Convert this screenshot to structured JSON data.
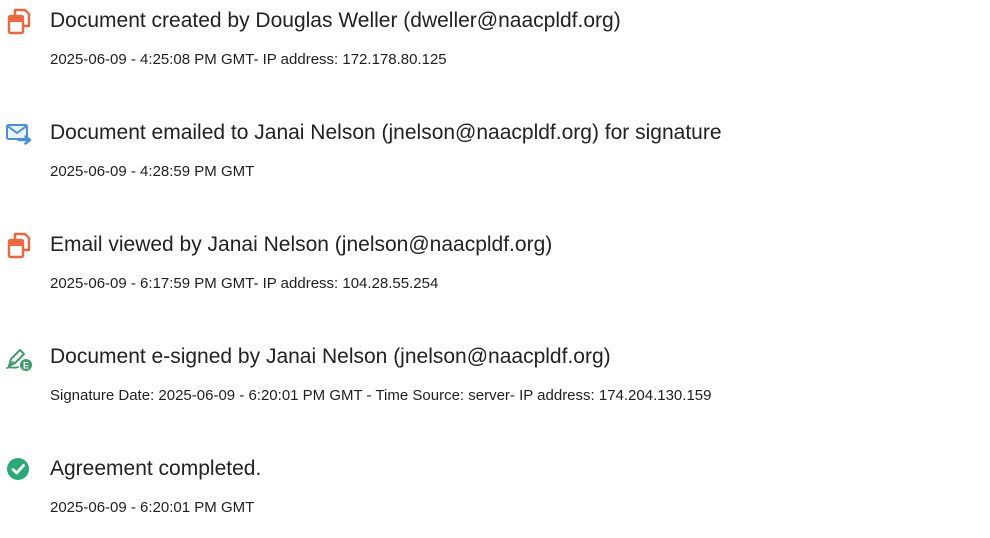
{
  "events": [
    {
      "icon": "document-created-icon",
      "title": "Document created by Douglas Weller (dweller@naacpldf.org)",
      "detail": "2025-06-09 - 4:25:08 PM GMT- IP address: 172.178.80.125"
    },
    {
      "icon": "email-sent-icon",
      "title": "Document emailed to Janai Nelson (jnelson@naacpldf.org) for signature",
      "detail": "2025-06-09 - 4:28:59 PM GMT"
    },
    {
      "icon": "email-viewed-icon",
      "title": "Email viewed by Janai Nelson (jnelson@naacpldf.org)",
      "detail": "2025-06-09 - 6:17:59 PM GMT- IP address: 104.28.55.254"
    },
    {
      "icon": "e-signature-icon",
      "title": "Document e-signed by Janai Nelson (jnelson@naacpldf.org)",
      "detail": "Signature Date: 2025-06-09 - 6:20:01 PM GMT - Time Source: server- IP address: 174.204.130.159"
    },
    {
      "icon": "checkmark-circle-icon",
      "title": "Agreement completed.",
      "detail": "2025-06-09 - 6:20:01 PM GMT"
    }
  ],
  "colors": {
    "document_icon": "#e8693f",
    "email_icon": "#4a90d9",
    "signature_icon": "#3f9a6b",
    "complete_icon": "#2aa876"
  }
}
